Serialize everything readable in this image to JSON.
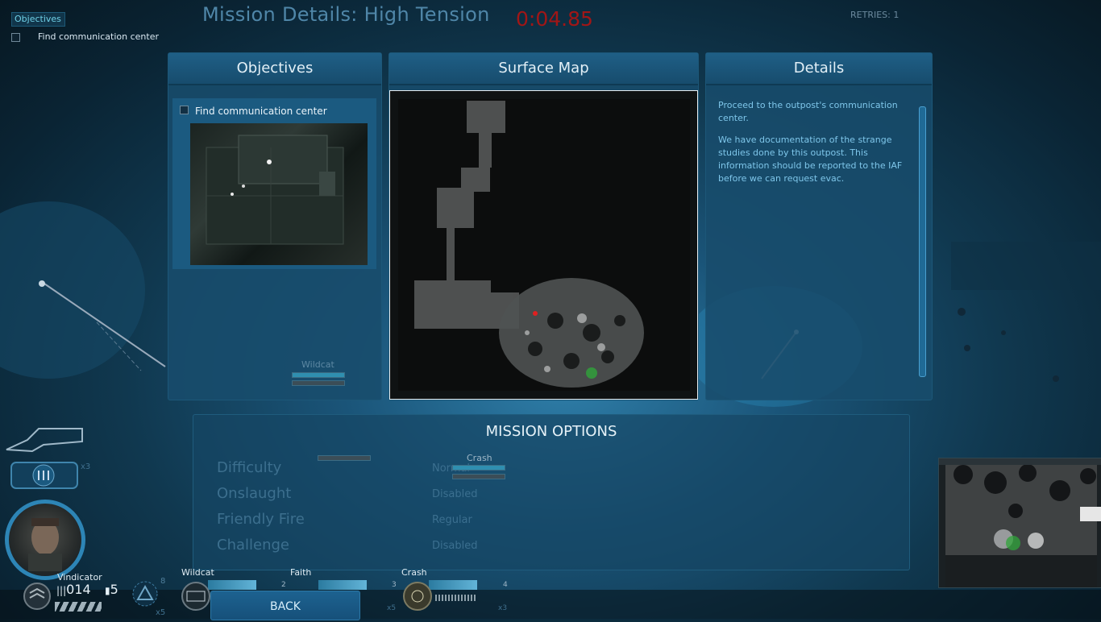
{
  "hud": {
    "objectives_tab": "Objectives",
    "objective_item": "Find communication center",
    "retries": "RETRIES: 1",
    "timer": "0:04.85"
  },
  "title": "Mission Details: High Tension",
  "panels": {
    "objectives": {
      "heading": "Objectives",
      "item": "Find communication center"
    },
    "map": {
      "heading": "Surface Map"
    },
    "details": {
      "heading": "Details",
      "paragraphs": [
        "Proceed to the outpost's communication center.",
        "We have documentation of the strange studies done by this outpost. This information should be reported to the IAF before we can request evac."
      ]
    }
  },
  "mission_options": {
    "heading": "MISSION OPTIONS",
    "rows": [
      {
        "label": "Difficulty",
        "value": "Normal"
      },
      {
        "label": "Onslaught",
        "value": "Disabled"
      },
      {
        "label": "Friendly Fire",
        "value": "Regular"
      },
      {
        "label": "Challenge",
        "value": "Disabled"
      }
    ]
  },
  "world_labels": {
    "wildcat": "Wildcat",
    "crash": "Crash"
  },
  "squad": {
    "leader": {
      "name": "Vindicator",
      "ammo": "014",
      "grenades": "5",
      "item_count": "8",
      "multiplier": "x5",
      "weapon_multiplier": "x3"
    },
    "members": [
      {
        "name": "Wildcat",
        "number": "2",
        "multiplier": ""
      },
      {
        "name": "Faith",
        "number": "3",
        "multiplier": "x5"
      },
      {
        "name": "Crash",
        "number": "4",
        "multiplier": "x3"
      }
    ]
  },
  "back_label": "BACK",
  "colors": {
    "accent": "#2f8fb0",
    "timer": "#a11616",
    "details_text": "#7ec6ea",
    "map_marker": "#e02020"
  }
}
